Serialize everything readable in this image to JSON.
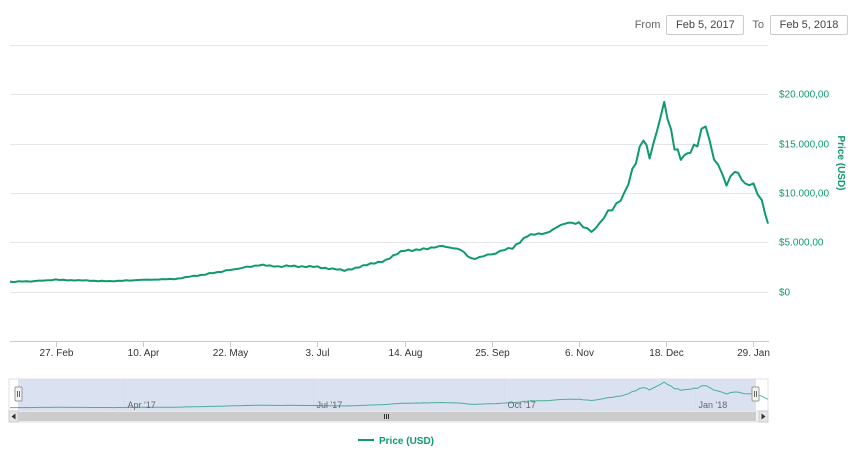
{
  "range_selector": {
    "from_label": "From",
    "from_value": "Feb 5, 2017",
    "to_label": "To",
    "to_value": "Feb 5, 2018"
  },
  "colors": {
    "series": "#0e9a6e",
    "axis_text": "#0e9a6e",
    "grid": "#e6e6e6",
    "navigator_mask": "#d3dcee"
  },
  "navigator": {
    "labels": [
      "Apr '17",
      "Jul '17",
      "Oct '17",
      "Jan '18"
    ],
    "scrollbar_grip_icon": "grip-lines-icon",
    "left_arrow_icon": "arrow-left-icon",
    "right_arrow_icon": "arrow-right-icon"
  },
  "chart_data": {
    "type": "line",
    "title": "",
    "xlabel": "",
    "ylabel": "Price (USD)",
    "y_axis_side": "right",
    "x_ticks": [
      "27. Feb",
      "10. Apr",
      "22. May",
      "3. Jul",
      "14. Aug",
      "25. Sep",
      "6. Nov",
      "18. Dec",
      "29. Jan"
    ],
    "y_ticks": [
      "$0",
      "$5.000,00",
      "$10.000,00",
      "$15.000,00",
      "$20.000,00"
    ],
    "ylim": [
      -5000,
      25000
    ],
    "xlim": [
      "2017-02-05",
      "2018-02-05"
    ],
    "grid": true,
    "legend_position": "bottom-center",
    "series": [
      {
        "name": "Price (USD)",
        "x": [
          "2017-02-05",
          "2017-02-15",
          "2017-02-27",
          "2017-03-10",
          "2017-03-25",
          "2017-04-10",
          "2017-04-25",
          "2017-05-10",
          "2017-05-22",
          "2017-06-05",
          "2017-06-12",
          "2017-06-20",
          "2017-07-03",
          "2017-07-16",
          "2017-07-25",
          "2017-08-05",
          "2017-08-14",
          "2017-08-25",
          "2017-09-01",
          "2017-09-10",
          "2017-09-15",
          "2017-09-25",
          "2017-10-05",
          "2017-10-12",
          "2017-10-21",
          "2017-11-01",
          "2017-11-06",
          "2017-11-12",
          "2017-11-20",
          "2017-11-28",
          "2017-12-07",
          "2017-12-10",
          "2017-12-17",
          "2017-12-22",
          "2017-12-25",
          "2017-12-28",
          "2018-01-02",
          "2018-01-06",
          "2018-01-10",
          "2018-01-16",
          "2018-01-20",
          "2018-01-25",
          "2018-01-29",
          "2018-02-02",
          "2018-02-05"
        ],
        "values": [
          1000,
          1050,
          1200,
          1150,
          1050,
          1200,
          1280,
          1750,
          2200,
          2700,
          2550,
          2600,
          2500,
          2150,
          2600,
          3200,
          4200,
          4300,
          4700,
          4200,
          3300,
          3800,
          4500,
          5600,
          6000,
          7000,
          7000,
          6000,
          8000,
          9800,
          15800,
          13800,
          19000,
          14500,
          13500,
          14000,
          15000,
          17000,
          13500,
          11000,
          12200,
          10800,
          11000,
          9000,
          6900
        ]
      }
    ]
  }
}
